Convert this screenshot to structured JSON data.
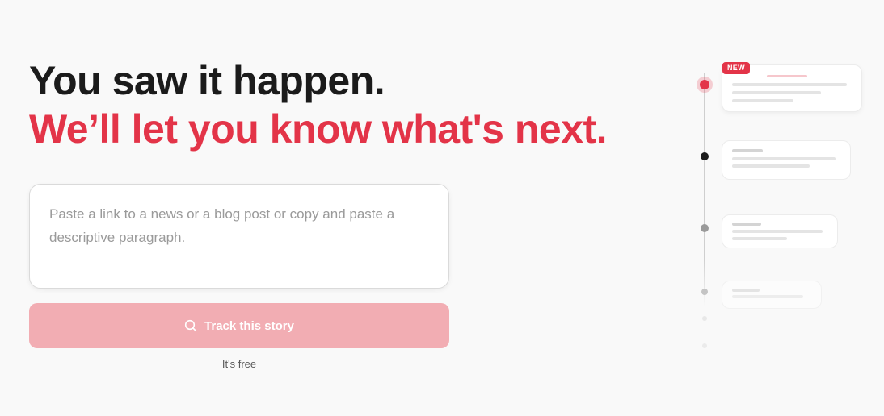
{
  "hero": {
    "headline_line1": "You saw it happen.",
    "headline_line2": "We’ll let you know what's next."
  },
  "story_input": {
    "value": "",
    "placeholder": "Paste a link to a news or a blog post or copy and paste a descriptive paragraph."
  },
  "track_button": {
    "label": "Track this story",
    "icon": "search-icon"
  },
  "free_note": "It's free",
  "timeline": {
    "badge": "NEW"
  },
  "colors": {
    "accent": "#e33448",
    "button_bg": "#f2adb3",
    "heading": "#1b1b1b",
    "background": "#f9f9f9"
  }
}
